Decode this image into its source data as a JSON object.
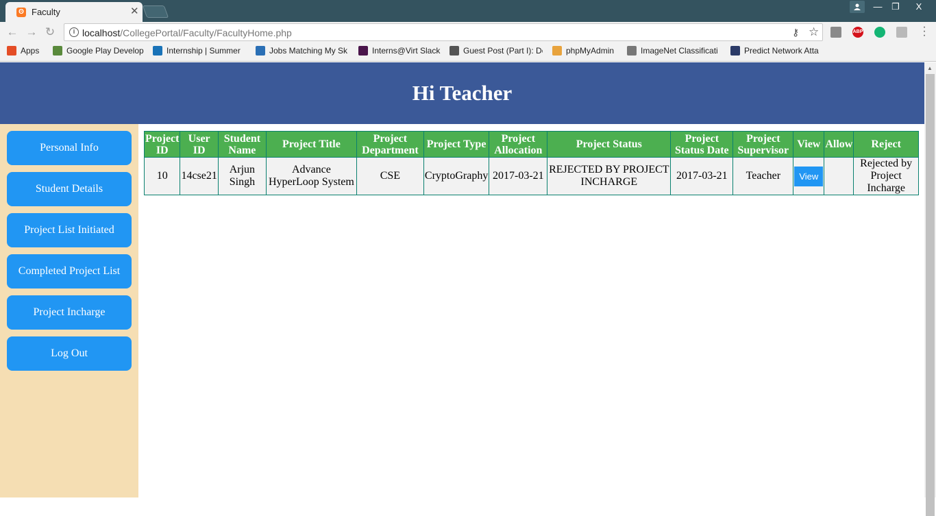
{
  "browser": {
    "tab_title": "Faculty",
    "tab_close": "✕",
    "url_host": "localhost",
    "url_path": "/CollegePortal/Faculty/FacultyHome.php",
    "window_controls": {
      "minimize": "—",
      "maximize": "❐",
      "close": "X"
    },
    "extensions": {
      "abp": "ABP"
    },
    "bookmarks": [
      {
        "label": "Apps",
        "icon": "apps-grid-icon",
        "color": "#e44d26"
      },
      {
        "label": "Google Play Develop",
        "icon": "google-play-icon",
        "color": "#5a8a3c"
      },
      {
        "label": "Internship | Summer",
        "icon": "internshala-icon",
        "color": "#1a73b8"
      },
      {
        "label": "Jobs Matching My Sk",
        "icon": "angellist-icon",
        "color": "#2a6fb5"
      },
      {
        "label": "Interns@Virt Slack",
        "icon": "slack-icon",
        "color": "#4a154b"
      },
      {
        "label": "Guest Post (Part I): De",
        "icon": "medium-icon",
        "color": "#555555"
      },
      {
        "label": "phpMyAdmin",
        "icon": "phpmyadmin-icon",
        "color": "#e8a33d"
      },
      {
        "label": "ImageNet Classificati",
        "icon": "imagenet-icon",
        "color": "#777777"
      },
      {
        "label": "Predict Network Atta",
        "icon": "hackerearth-icon",
        "color": "#2b3a67"
      }
    ]
  },
  "page": {
    "heading": "Hi Teacher",
    "colors": {
      "header": "#3b5998",
      "sidebar": "#f5deb3",
      "button": "#2196f3",
      "table_header": "#4caf50"
    }
  },
  "sidebar": {
    "items": [
      {
        "label": "Personal Info"
      },
      {
        "label": "Student Details"
      },
      {
        "label": "Project List Initiated"
      },
      {
        "label": "Completed Project List"
      },
      {
        "label": "Project Incharge"
      },
      {
        "label": "Log Out"
      }
    ]
  },
  "table": {
    "headers": [
      "Project ID",
      "User ID",
      "Student Name",
      "Project Title",
      "Project Department",
      "Project Type",
      "Project Allocation",
      "Project Status",
      "Project Status Date",
      "Project Supervisor",
      "View",
      "Allow",
      "Reject"
    ],
    "rows": [
      {
        "project_id": "10",
        "user_id": "14cse21",
        "student_name": "Arjun Singh",
        "project_title": "Advance HyperLoop System",
        "project_department": "CSE",
        "project_type": "CryptoGraphy",
        "project_allocation": "2017-03-21",
        "project_status": "REJECTED BY PROJECT INCHARGE",
        "project_status_date": "2017-03-21",
        "project_supervisor": "Teacher",
        "view_label": "View",
        "allow": "",
        "reject": "Rejected by Project Incharge"
      }
    ]
  }
}
